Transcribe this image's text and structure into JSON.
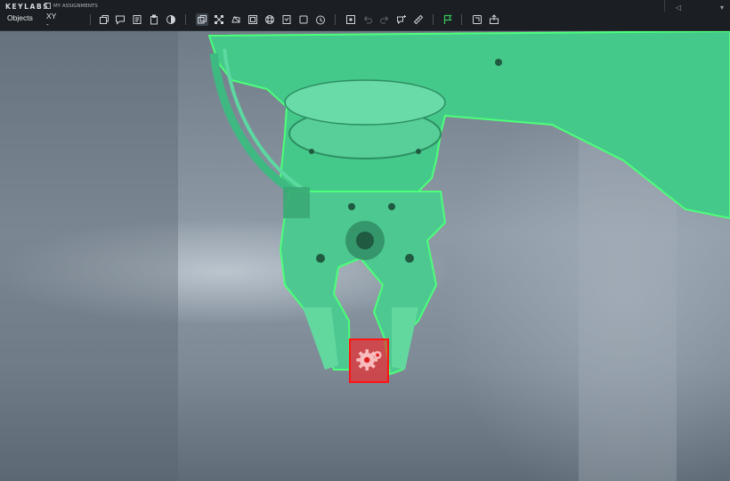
{
  "app": {
    "brand": "KEYLABS",
    "assignments_label": "MY ASSIGNMENTS"
  },
  "panel": {
    "objects_label": "Objects",
    "xy_label": "XY",
    "xy_value": "-"
  },
  "toolbar": {
    "groups": [
      [
        "object-tool",
        "comment-tool",
        "notes-tool",
        "clipboard-tool",
        "contrast-tool"
      ],
      [
        "bounding-box-tool",
        "keypoints-tool",
        "polygon-tool",
        "cuboid-tool",
        "segmentation-tool",
        "classification-tool",
        "frame-tool",
        "timer-tool"
      ],
      [
        "select-tool",
        "undo",
        "redo",
        "comment-add-tool",
        "ruler-tool"
      ],
      [
        "flag-tool"
      ],
      [
        "shortcuts-tool",
        "export-tool"
      ]
    ]
  },
  "annotations": [
    {
      "type": "polygon",
      "label_color": "#3fe08a",
      "target": "robotic arm"
    },
    {
      "type": "bounding-box",
      "label_color": "#ff1414",
      "target": "gear"
    }
  ],
  "colors": {
    "topbar": "#1b1f23",
    "polygon_fill": "#45c98a",
    "polygon_stroke": "#4dff7a",
    "bbox_stroke": "#ff1414",
    "flag_active": "#37c85a"
  }
}
